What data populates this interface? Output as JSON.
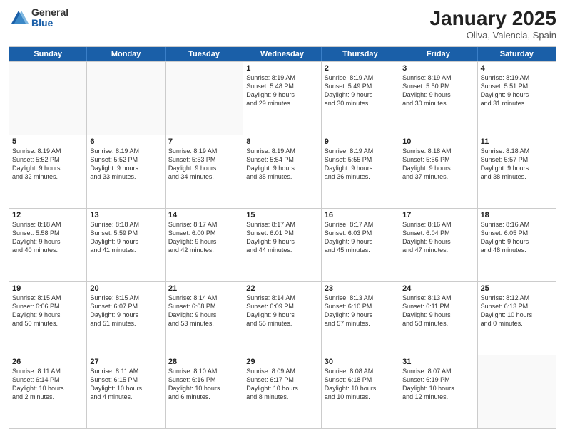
{
  "logo": {
    "general": "General",
    "blue": "Blue"
  },
  "title": "January 2025",
  "location": "Oliva, Valencia, Spain",
  "header_days": [
    "Sunday",
    "Monday",
    "Tuesday",
    "Wednesday",
    "Thursday",
    "Friday",
    "Saturday"
  ],
  "rows": [
    [
      {
        "day": "",
        "lines": [],
        "empty": true
      },
      {
        "day": "",
        "lines": [],
        "empty": true
      },
      {
        "day": "",
        "lines": [],
        "empty": true
      },
      {
        "day": "1",
        "lines": [
          "Sunrise: 8:19 AM",
          "Sunset: 5:48 PM",
          "Daylight: 9 hours",
          "and 29 minutes."
        ],
        "empty": false
      },
      {
        "day": "2",
        "lines": [
          "Sunrise: 8:19 AM",
          "Sunset: 5:49 PM",
          "Daylight: 9 hours",
          "and 30 minutes."
        ],
        "empty": false
      },
      {
        "day": "3",
        "lines": [
          "Sunrise: 8:19 AM",
          "Sunset: 5:50 PM",
          "Daylight: 9 hours",
          "and 30 minutes."
        ],
        "empty": false
      },
      {
        "day": "4",
        "lines": [
          "Sunrise: 8:19 AM",
          "Sunset: 5:51 PM",
          "Daylight: 9 hours",
          "and 31 minutes."
        ],
        "empty": false
      }
    ],
    [
      {
        "day": "5",
        "lines": [
          "Sunrise: 8:19 AM",
          "Sunset: 5:52 PM",
          "Daylight: 9 hours",
          "and 32 minutes."
        ],
        "empty": false
      },
      {
        "day": "6",
        "lines": [
          "Sunrise: 8:19 AM",
          "Sunset: 5:52 PM",
          "Daylight: 9 hours",
          "and 33 minutes."
        ],
        "empty": false
      },
      {
        "day": "7",
        "lines": [
          "Sunrise: 8:19 AM",
          "Sunset: 5:53 PM",
          "Daylight: 9 hours",
          "and 34 minutes."
        ],
        "empty": false
      },
      {
        "day": "8",
        "lines": [
          "Sunrise: 8:19 AM",
          "Sunset: 5:54 PM",
          "Daylight: 9 hours",
          "and 35 minutes."
        ],
        "empty": false
      },
      {
        "day": "9",
        "lines": [
          "Sunrise: 8:19 AM",
          "Sunset: 5:55 PM",
          "Daylight: 9 hours",
          "and 36 minutes."
        ],
        "empty": false
      },
      {
        "day": "10",
        "lines": [
          "Sunrise: 8:18 AM",
          "Sunset: 5:56 PM",
          "Daylight: 9 hours",
          "and 37 minutes."
        ],
        "empty": false
      },
      {
        "day": "11",
        "lines": [
          "Sunrise: 8:18 AM",
          "Sunset: 5:57 PM",
          "Daylight: 9 hours",
          "and 38 minutes."
        ],
        "empty": false
      }
    ],
    [
      {
        "day": "12",
        "lines": [
          "Sunrise: 8:18 AM",
          "Sunset: 5:58 PM",
          "Daylight: 9 hours",
          "and 40 minutes."
        ],
        "empty": false
      },
      {
        "day": "13",
        "lines": [
          "Sunrise: 8:18 AM",
          "Sunset: 5:59 PM",
          "Daylight: 9 hours",
          "and 41 minutes."
        ],
        "empty": false
      },
      {
        "day": "14",
        "lines": [
          "Sunrise: 8:17 AM",
          "Sunset: 6:00 PM",
          "Daylight: 9 hours",
          "and 42 minutes."
        ],
        "empty": false
      },
      {
        "day": "15",
        "lines": [
          "Sunrise: 8:17 AM",
          "Sunset: 6:01 PM",
          "Daylight: 9 hours",
          "and 44 minutes."
        ],
        "empty": false
      },
      {
        "day": "16",
        "lines": [
          "Sunrise: 8:17 AM",
          "Sunset: 6:03 PM",
          "Daylight: 9 hours",
          "and 45 minutes."
        ],
        "empty": false
      },
      {
        "day": "17",
        "lines": [
          "Sunrise: 8:16 AM",
          "Sunset: 6:04 PM",
          "Daylight: 9 hours",
          "and 47 minutes."
        ],
        "empty": false
      },
      {
        "day": "18",
        "lines": [
          "Sunrise: 8:16 AM",
          "Sunset: 6:05 PM",
          "Daylight: 9 hours",
          "and 48 minutes."
        ],
        "empty": false
      }
    ],
    [
      {
        "day": "19",
        "lines": [
          "Sunrise: 8:15 AM",
          "Sunset: 6:06 PM",
          "Daylight: 9 hours",
          "and 50 minutes."
        ],
        "empty": false
      },
      {
        "day": "20",
        "lines": [
          "Sunrise: 8:15 AM",
          "Sunset: 6:07 PM",
          "Daylight: 9 hours",
          "and 51 minutes."
        ],
        "empty": false
      },
      {
        "day": "21",
        "lines": [
          "Sunrise: 8:14 AM",
          "Sunset: 6:08 PM",
          "Daylight: 9 hours",
          "and 53 minutes."
        ],
        "empty": false
      },
      {
        "day": "22",
        "lines": [
          "Sunrise: 8:14 AM",
          "Sunset: 6:09 PM",
          "Daylight: 9 hours",
          "and 55 minutes."
        ],
        "empty": false
      },
      {
        "day": "23",
        "lines": [
          "Sunrise: 8:13 AM",
          "Sunset: 6:10 PM",
          "Daylight: 9 hours",
          "and 57 minutes."
        ],
        "empty": false
      },
      {
        "day": "24",
        "lines": [
          "Sunrise: 8:13 AM",
          "Sunset: 6:11 PM",
          "Daylight: 9 hours",
          "and 58 minutes."
        ],
        "empty": false
      },
      {
        "day": "25",
        "lines": [
          "Sunrise: 8:12 AM",
          "Sunset: 6:13 PM",
          "Daylight: 10 hours",
          "and 0 minutes."
        ],
        "empty": false
      }
    ],
    [
      {
        "day": "26",
        "lines": [
          "Sunrise: 8:11 AM",
          "Sunset: 6:14 PM",
          "Daylight: 10 hours",
          "and 2 minutes."
        ],
        "empty": false
      },
      {
        "day": "27",
        "lines": [
          "Sunrise: 8:11 AM",
          "Sunset: 6:15 PM",
          "Daylight: 10 hours",
          "and 4 minutes."
        ],
        "empty": false
      },
      {
        "day": "28",
        "lines": [
          "Sunrise: 8:10 AM",
          "Sunset: 6:16 PM",
          "Daylight: 10 hours",
          "and 6 minutes."
        ],
        "empty": false
      },
      {
        "day": "29",
        "lines": [
          "Sunrise: 8:09 AM",
          "Sunset: 6:17 PM",
          "Daylight: 10 hours",
          "and 8 minutes."
        ],
        "empty": false
      },
      {
        "day": "30",
        "lines": [
          "Sunrise: 8:08 AM",
          "Sunset: 6:18 PM",
          "Daylight: 10 hours",
          "and 10 minutes."
        ],
        "empty": false
      },
      {
        "day": "31",
        "lines": [
          "Sunrise: 8:07 AM",
          "Sunset: 6:19 PM",
          "Daylight: 10 hours",
          "and 12 minutes."
        ],
        "empty": false
      },
      {
        "day": "",
        "lines": [],
        "empty": true
      }
    ]
  ]
}
